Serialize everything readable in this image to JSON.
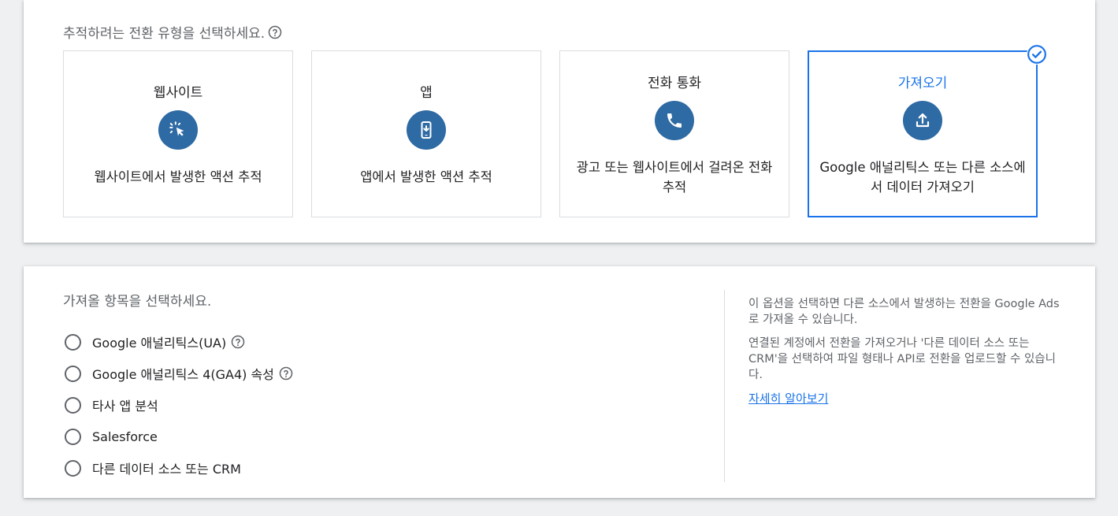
{
  "top": {
    "prompt": "추적하려는 전환 유형을 선택하세요.",
    "cards": [
      {
        "title": "웹사이트",
        "desc": "웹사이트에서 발생한 액션 추적",
        "icon": "cursor-click-icon"
      },
      {
        "title": "앱",
        "desc": "앱에서 발생한 액션 추적",
        "icon": "phone-download-icon"
      },
      {
        "title": "전화 통화",
        "desc": "광고 또는 웹사이트에서 걸려온 전화 추적",
        "icon": "phone-icon"
      },
      {
        "title": "가져오기",
        "desc": "Google 애널리틱스 또는 다른 소스에서 데이터 가져오기",
        "icon": "upload-icon",
        "selected": true
      }
    ]
  },
  "bottom": {
    "prompt": "가져올 항목을 선택하세요.",
    "options": [
      {
        "label": "Google 애널리틱스(UA)",
        "help": true
      },
      {
        "label": "Google 애널리틱스 4(GA4) 속성",
        "help": true
      },
      {
        "label": "타사 앱 분석",
        "help": false
      },
      {
        "label": "Salesforce",
        "help": false
      },
      {
        "label": "다른 데이터 소스 또는 CRM",
        "help": false
      }
    ],
    "side": {
      "p1": "이 옵션을 선택하면 다른 소스에서 발생하는 전환을 Google Ads로 가져올 수 있습니다.",
      "p2": "연결된 계정에서 전환을 가져오거나 '다른 데이터 소스 또는 CRM'을 선택하여 파일 형태나 API로 전환을 업로드할 수 있습니다.",
      "link": "자세히 알아보기"
    }
  },
  "colors": {
    "accent": "#1a73e8",
    "icon_bg": "#2e6aa3"
  }
}
